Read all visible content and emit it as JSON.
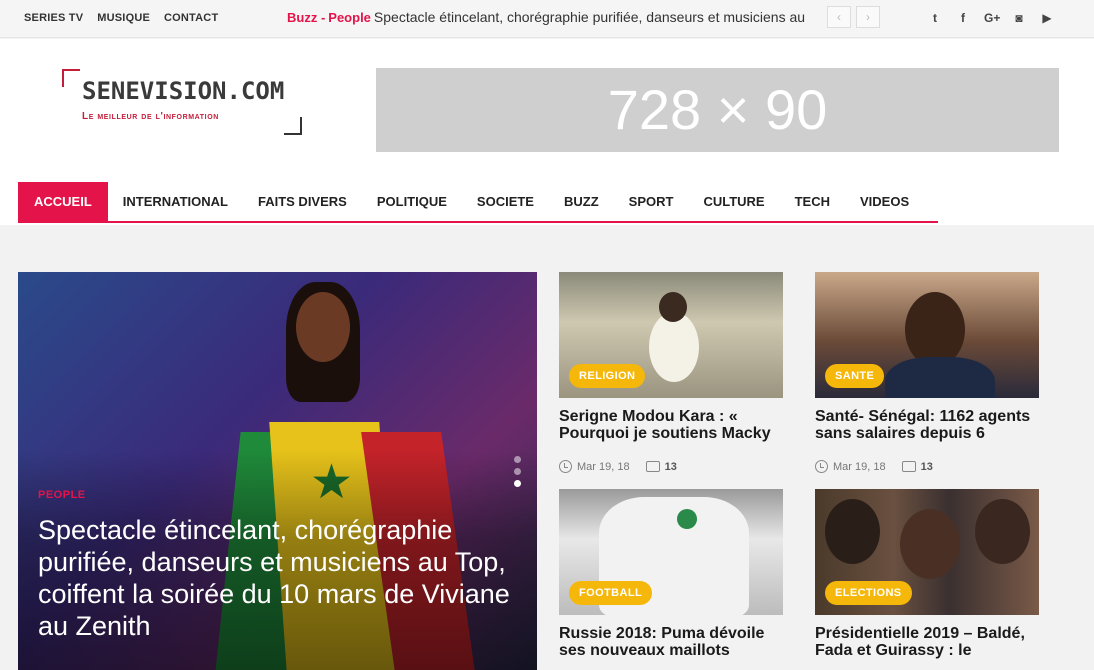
{
  "topbar": {
    "links": [
      "SERIES TV",
      "MUSIQUE",
      "CONTACT"
    ],
    "ticker_label1": "Buzz -",
    "ticker_label2": "People",
    "ticker_text": "Spectacle étincelant, chorégraphie purifiée, danseurs et musiciens au",
    "prev": "‹",
    "next": "›",
    "social": [
      "twitter-icon",
      "facebook-icon",
      "google-plus-icon",
      "instagram-icon",
      "youtube-icon"
    ]
  },
  "logo": {
    "name": "SENEVISION.COM",
    "tagline": "Le meilleur de l'information"
  },
  "ad": {
    "text": "728 × 90"
  },
  "nav": [
    "ACCUEIL",
    "INTERNATIONAL",
    "FAITS DIVERS",
    "POLITIQUE",
    "SOCIETE",
    "BUZZ",
    "SPORT",
    "CULTURE",
    "TECH",
    "VIDEOS"
  ],
  "feature": {
    "category": "PEOPLE",
    "title": "Spectacle étincelant, chorégraphie purifiée, danseurs et musiciens au Top, coiffent la soirée du 10 mars de Viviane au Zenith"
  },
  "cards": [
    {
      "category": "RELIGION",
      "title": "Serigne Modou Kara : « Pourquoi je soutiens Macky",
      "date": "Mar 19, 18",
      "comments": "13"
    },
    {
      "category": "SANTE",
      "title": "Santé- Sénégal: 1162 agents sans salaires depuis 6",
      "date": "Mar 19, 18",
      "comments": "13"
    },
    {
      "category": "FOOTBALL",
      "title": "Russie 2018: Puma dévoile ses nouveaux maillots",
      "date": "",
      "comments": ""
    },
    {
      "category": "ELECTIONS",
      "title": "Présidentielle 2019 – Baldé, Fada et Guirassy : le",
      "date": "",
      "comments": ""
    }
  ],
  "colors": {
    "accent": "#e4144a",
    "badge": "#f5b70a"
  }
}
